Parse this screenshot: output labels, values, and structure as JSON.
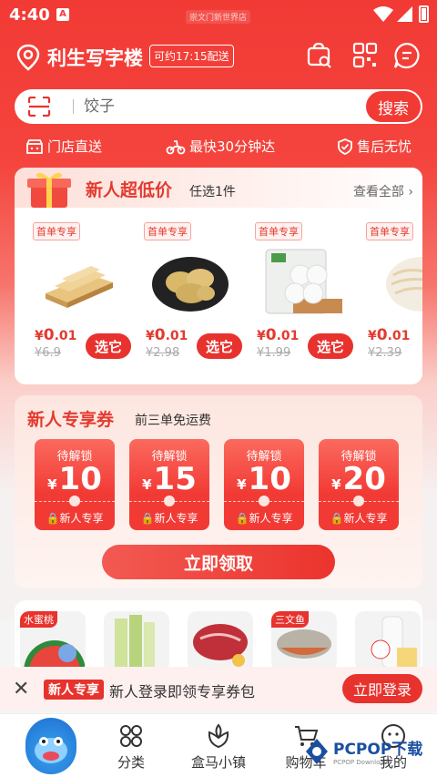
{
  "status_bar": {
    "time": "4:40",
    "app_icon": "A",
    "store_tag": "崇文门新世界店"
  },
  "header": {
    "address": "利生写字楼",
    "delivery_eta": "可约17:15配送",
    "icons": [
      "location-pin-icon",
      "shopping-bag-search-icon",
      "qr-code-icon",
      "message-bubble-icon"
    ]
  },
  "search": {
    "placeholder": "饺子",
    "button_label": "搜索"
  },
  "features": [
    {
      "label": "门店直送",
      "icon": "store-icon"
    },
    {
      "label": "最快30分钟达",
      "icon": "scooter-icon"
    },
    {
      "label": "售后无忧",
      "icon": "shield-check-icon"
    }
  ],
  "new_user": {
    "title": "新人超低价",
    "subtitle": "任选1件",
    "see_all": "查看全部",
    "tag": "首单专享",
    "pick_label": "选它",
    "products": [
      {
        "name": "tofu",
        "price_symbol": "¥",
        "price_int": "0",
        "price_dec": ".01",
        "original": "¥6.9"
      },
      {
        "name": "potato",
        "price_symbol": "¥",
        "price_int": "0",
        "price_dec": ".01",
        "original": "¥2.98"
      },
      {
        "name": "buns",
        "price_symbol": "¥",
        "price_int": "0",
        "price_dec": ".01",
        "original": "¥1.99"
      },
      {
        "name": "noodles",
        "price_symbol": "¥",
        "price_int": "0",
        "price_dec": ".01",
        "original": "¥2.39"
      }
    ]
  },
  "coupons": {
    "title": "新人专享券",
    "subtitle": "前三单免运费",
    "lock_label": "待解锁",
    "currency": "¥",
    "footer": "新人专享",
    "items": [
      {
        "amount": "10"
      },
      {
        "amount": "15"
      },
      {
        "amount": "10"
      },
      {
        "amount": "20"
      }
    ],
    "claim_button": "立即领取"
  },
  "categories": [
    {
      "tag": "水蜜桃",
      "name": "watermelon"
    },
    {
      "tag": "",
      "name": "vegetables"
    },
    {
      "tag": "",
      "name": "beef"
    },
    {
      "tag": "三文鱼",
      "name": "fish"
    },
    {
      "tag": "",
      "name": "milk"
    }
  ],
  "promo": {
    "tag": "新人专享",
    "text": "新人登录即领专享券包",
    "button": "立即登录"
  },
  "tabbar": [
    {
      "label": "",
      "icon": "hippo-mascot-icon"
    },
    {
      "label": "分类",
      "icon": "category-grid-icon"
    },
    {
      "label": "盒马小镇",
      "icon": "tulip-icon"
    },
    {
      "label": "购物车",
      "icon": "cart-icon"
    },
    {
      "label": "我的",
      "icon": "smiley-face-icon"
    }
  ],
  "watermark": {
    "text": "PCPOP下载",
    "small": "PCPOP Downloads"
  },
  "colors": {
    "brand_red": "#f23a35",
    "tag_red": "#e8322d"
  }
}
